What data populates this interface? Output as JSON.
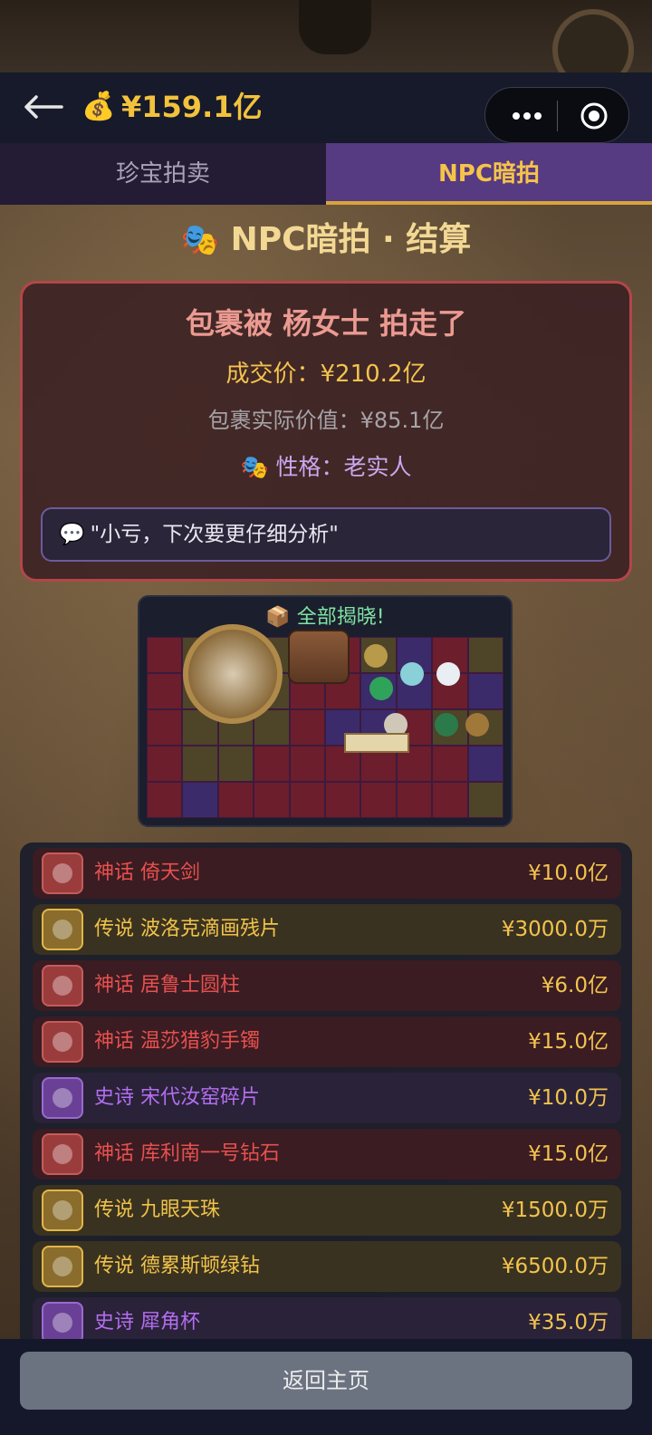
{
  "header": {
    "balance": "¥159.1亿",
    "coin_icon": "money-bag-icon"
  },
  "tabs": [
    {
      "label": "珍宝拍卖",
      "active": false
    },
    {
      "label": "NPC暗拍",
      "active": true
    }
  ],
  "result": {
    "title": "NPC暗拍 · 结算",
    "headline": "包裹被 杨女士 拍走了",
    "deal_price": "成交价：¥210.2亿",
    "actual_value": "包裹实际价值：¥85.1亿",
    "personality": "性格：老实人",
    "quote": "\"小亏，下次要更仔细分析\""
  },
  "reveal": {
    "title": "全部揭晓!"
  },
  "items": [
    {
      "tier": "mythic",
      "label": "神话 倚天剑",
      "price": "¥10.0亿"
    },
    {
      "tier": "legend",
      "label": "传说 波洛克滴画残片",
      "price": "¥3000.0万"
    },
    {
      "tier": "mythic",
      "label": "神话 居鲁士圆柱",
      "price": "¥6.0亿"
    },
    {
      "tier": "mythic",
      "label": "神话 温莎猎豹手镯",
      "price": "¥15.0亿"
    },
    {
      "tier": "epic",
      "label": "史诗 宋代汝窑碎片",
      "price": "¥10.0万"
    },
    {
      "tier": "mythic",
      "label": "神话 库利南一号钻石",
      "price": "¥15.0亿"
    },
    {
      "tier": "legend",
      "label": "传说 九眼天珠",
      "price": "¥1500.0万"
    },
    {
      "tier": "legend",
      "label": "传说 德累斯顿绿钻",
      "price": "¥6500.0万"
    },
    {
      "tier": "epic",
      "label": "史诗 犀角杯",
      "price": "¥35.0万"
    }
  ],
  "footer": {
    "home_button": "返回主页"
  },
  "colors": {
    "gold": "#f3c34f",
    "mythic": "#e8504e",
    "legend": "#f0c34a",
    "epic": "#b36df0"
  }
}
